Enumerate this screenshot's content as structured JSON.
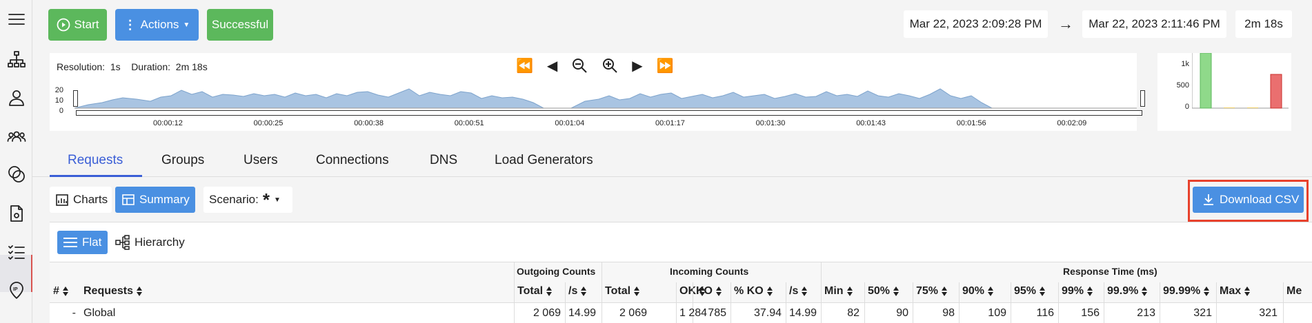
{
  "toolbar": {
    "start_label": "Start",
    "actions_label": "Actions",
    "status_label": "Successful",
    "start_time": "Mar 22, 2023 2:09:28 PM",
    "arrow": "→",
    "end_time": "Mar 22, 2023 2:11:46 PM",
    "duration": "2m 18s"
  },
  "timeline": {
    "resolution_label": "Resolution:",
    "resolution_value": "1s",
    "duration_label": "Duration:",
    "duration_value": "2m 18s",
    "y_ticks": [
      "20",
      "10",
      "0"
    ],
    "x_ticks": [
      "00:00:12",
      "00:00:25",
      "00:00:38",
      "00:00:51",
      "00:01:04",
      "00:01:17",
      "00:01:30",
      "00:01:43",
      "00:01:56",
      "00:02:09"
    ]
  },
  "mini_chart": {
    "y_ticks": [
      "1k",
      "500",
      "0"
    ],
    "colors": [
      "#8fd98a",
      "#f3d36b",
      "#f3d36b",
      "#ea6f6f"
    ]
  },
  "tabs": [
    "Requests",
    "Groups",
    "Users",
    "Connections",
    "DNS",
    "Load Generators"
  ],
  "view": {
    "charts_label": "Charts",
    "summary_label": "Summary",
    "scenario_label": "Scenario:",
    "scenario_value": "*",
    "download_label": "Download CSV"
  },
  "table": {
    "flat_label": "Flat",
    "hierarchy_label": "Hierarchy",
    "groups": {
      "outgoing": "Outgoing Counts",
      "incoming": "Incoming Counts",
      "response": "Response Time (ms)"
    },
    "headers": [
      "#",
      "Requests",
      "Total",
      "/s",
      "Total",
      "OK",
      "KO",
      "% KO",
      "/s",
      "Min",
      "50%",
      "75%",
      "90%",
      "95%",
      "99%",
      "99.9%",
      "99.99%",
      "Max",
      "Me"
    ],
    "row": [
      "-",
      "Global",
      "2 069",
      "14.99",
      "2 069",
      "1 284",
      "785",
      "37.94",
      "14.99",
      "82",
      "90",
      "98",
      "109",
      "116",
      "156",
      "213",
      "321",
      "321",
      ""
    ]
  },
  "colors": {
    "green": "#5cb85c",
    "blue": "#4a90e2",
    "accent": "#3a5ed6",
    "highlight": "#e8412c"
  }
}
